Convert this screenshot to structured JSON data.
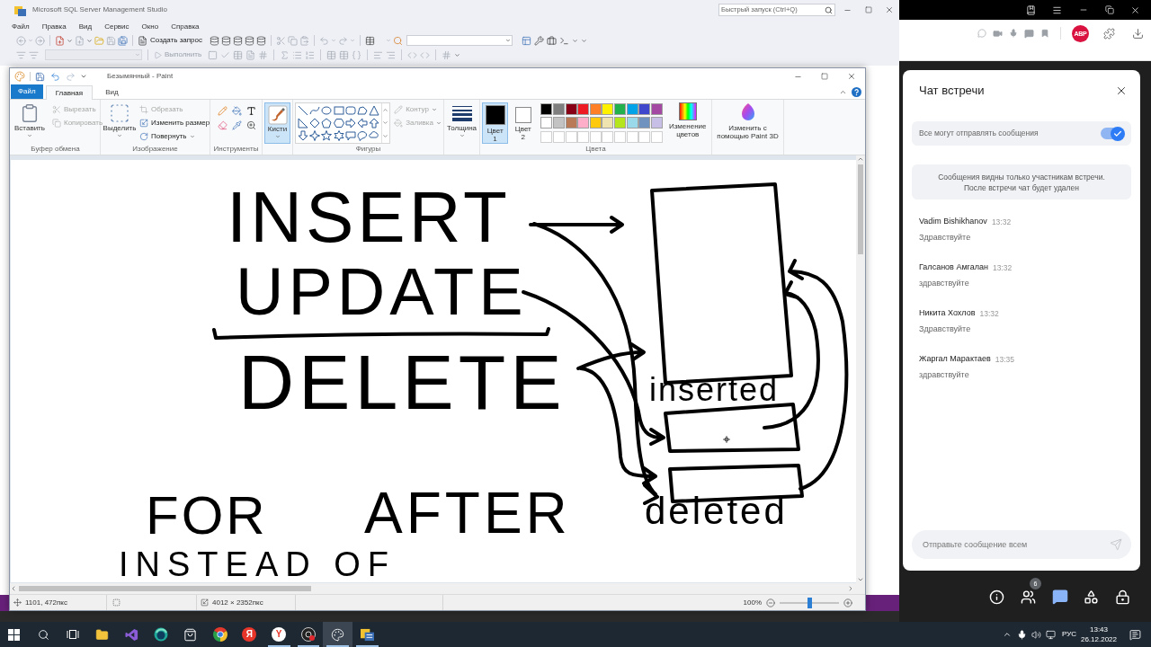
{
  "ssms": {
    "title": "Microsoft SQL Server Management Studio",
    "quick_launch": {
      "placeholder": "Быстрый запуск (Ctrl+Q)"
    },
    "menu": [
      "Файл",
      "Правка",
      "Вид",
      "Сервис",
      "Окно",
      "Справка"
    ],
    "new_query": "Создать запрос",
    "execute": {
      "label": "Выполнить",
      "disabled": true
    }
  },
  "paint": {
    "title": "Безымянный - Paint",
    "tabs": [
      {
        "label": "Файл",
        "kind": "file",
        "selected": false
      },
      {
        "label": "Главная",
        "kind": "tab",
        "selected": true
      },
      {
        "label": "Вид",
        "kind": "tab",
        "selected": false
      }
    ],
    "ribbon": {
      "clipboard": {
        "label": "Буфер обмена",
        "paste": "Вставить",
        "actions": [
          {
            "kind": "cut",
            "label": "Вырезать",
            "disabled": true
          },
          {
            "kind": "copy",
            "label": "Копировать",
            "disabled": true
          }
        ]
      },
      "image": {
        "label": "Изображение",
        "select": "Выделить",
        "actions": [
          {
            "kind": "crop",
            "label": "Обрезать",
            "disabled": true
          },
          {
            "kind": "resize",
            "label": "Изменить размер",
            "disabled": false
          },
          {
            "kind": "rotate",
            "label": "Повернуть",
            "disabled": false
          }
        ]
      },
      "tools": {
        "label": "Инструменты"
      },
      "brushes": {
        "label": "Кисти",
        "selected": true
      },
      "shapes": {
        "label": "Фигуры",
        "actions": [
          {
            "kind": "outline",
            "label": "Контур",
            "disabled": true
          },
          {
            "kind": "fill",
            "label": "Заливка",
            "disabled": true
          }
        ]
      },
      "size": {
        "label": "Толщина"
      },
      "colors": {
        "label": "Цвета",
        "slots": [
          {
            "label": "Цвет 1",
            "color": "#000000",
            "selected": true
          },
          {
            "label": "Цвет 2",
            "color": "#ffffff",
            "selected": false
          }
        ],
        "palette": [
          {
            "color": "#000000"
          },
          {
            "color": "#7f7f7f"
          },
          {
            "color": "#880015"
          },
          {
            "color": "#ed1c24"
          },
          {
            "color": "#ff7f27"
          },
          {
            "color": "#fff200"
          },
          {
            "color": "#22b14c"
          },
          {
            "color": "#00a2e8"
          },
          {
            "color": "#3f48cc"
          },
          {
            "color": "#a349a4"
          },
          {
            "color": "#ffffff"
          },
          {
            "color": "#c3c3c3"
          },
          {
            "color": "#b97a57"
          },
          {
            "color": "#ffaec9"
          },
          {
            "color": "#ffc90e"
          },
          {
            "color": "#efe4b0"
          },
          {
            "color": "#b5e61d"
          },
          {
            "color": "#99d9ea"
          },
          {
            "color": "#7092be"
          },
          {
            "color": "#c8bfe7"
          }
        ],
        "edit_colors": "Изменение цветов"
      },
      "paint3d": "Изменить с помощью Paint 3D"
    },
    "canvas": {
      "words": [
        "INSERT",
        "UPDATE",
        "DELETE",
        "inserted",
        "FOR",
        "AFTER",
        "deleted",
        "INSTEAD OF"
      ]
    },
    "status_bar": {
      "cursor": "1101, 472пкс",
      "size": "4012 × 2352пкс",
      "zoom": "100%",
      "zoom_slider": {
        "level": 0.5
      }
    }
  },
  "browser": {
    "adblock_badge": "ABP"
  },
  "chat": {
    "title": "Чат встречи",
    "permission": {
      "label": "Все могут отправлять сообщения",
      "on": true
    },
    "notice": "Сообщения видны только участникам встречи. После встречи чат будет удален",
    "messages": [
      {
        "author": "Vadim Bishikhanov",
        "time": "13:32",
        "text": "Здравствуйте"
      },
      {
        "author": "Галсанов Амгалан",
        "time": "13:32",
        "text": "здравствуйте"
      },
      {
        "author": "Никита Хохлов",
        "time": "13:32",
        "text": "Здравствуйте"
      },
      {
        "author": "Жаргал Марактаев",
        "time": "13:35",
        "text": "здравствуйте"
      }
    ],
    "input": {
      "placeholder": "Отправьте сообщение всем"
    }
  },
  "meeting_bar": {
    "buttons": [
      {
        "kind": "info",
        "selected": false
      },
      {
        "kind": "participants",
        "selected": false,
        "badge": "6"
      },
      {
        "kind": "chat",
        "selected": true
      },
      {
        "kind": "apps",
        "selected": false
      },
      {
        "kind": "security",
        "selected": false
      }
    ]
  },
  "taskbar": {
    "apps": [
      {
        "kind": "folder",
        "running": false,
        "active": false
      },
      {
        "kind": "ribbon",
        "running": false,
        "active": false
      },
      {
        "kind": "ring",
        "running": false,
        "active": false
      },
      {
        "kind": "store",
        "running": false,
        "active": false
      },
      {
        "kind": "segmented",
        "running": false,
        "active": false
      },
      {
        "kind": "letter",
        "glyph": "Я",
        "running": false,
        "active": false
      },
      {
        "kind": "letter_light",
        "glyph": "Y",
        "running": true,
        "active": false
      },
      {
        "kind": "recorder",
        "running": true,
        "active": false
      },
      {
        "kind": "palette",
        "running": true,
        "active": true
      },
      {
        "kind": "database",
        "running": true,
        "active": false
      }
    ],
    "tray": {
      "language": "РУС",
      "time": "13:43",
      "date": "26.12.2022"
    }
  }
}
